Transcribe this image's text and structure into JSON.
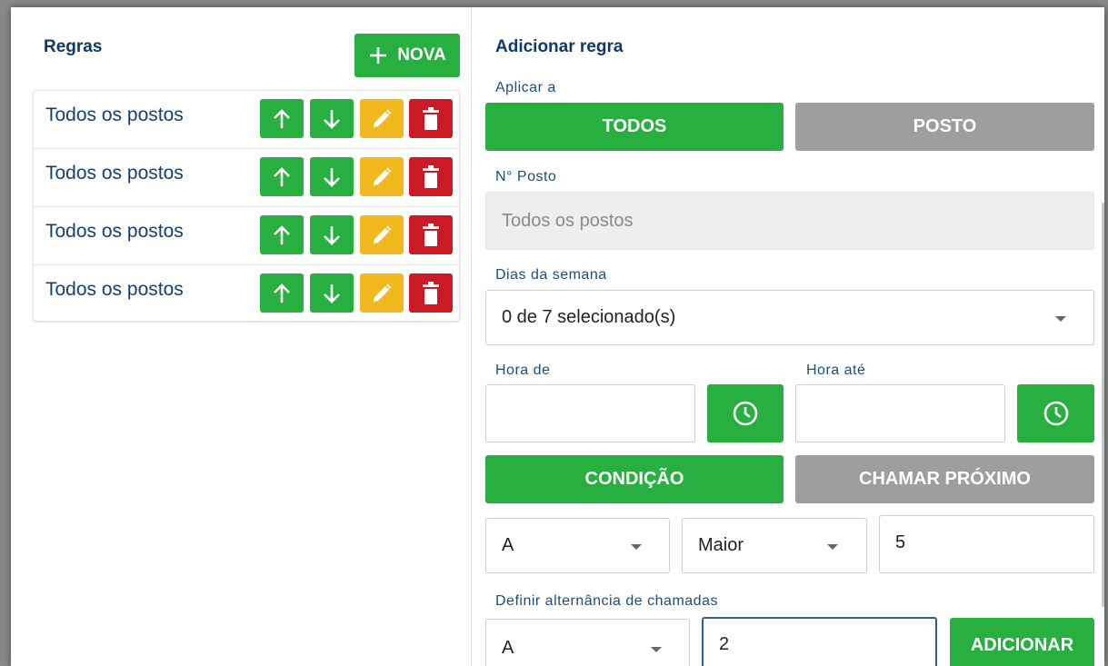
{
  "left": {
    "title": "Regras",
    "new_button": "NOVA",
    "rules": [
      {
        "label": "Todos os postos"
      },
      {
        "label": "Todos os postos"
      },
      {
        "label": "Todos os postos"
      },
      {
        "label": "Todos os postos"
      }
    ]
  },
  "right": {
    "title": "Adicionar regra",
    "apply_label": "Aplicar a",
    "apply_options": {
      "todos": "TODOS",
      "posto": "POSTO"
    },
    "apply_selected": "TODOS",
    "posto_label": "N° Posto",
    "posto_placeholder": "Todos os postos",
    "days_label": "Dias da semana",
    "days_value": "0 de 7 selecionado(s)",
    "hora_de_label": "Hora de",
    "hora_ate_label": "Hora até",
    "mode_options": {
      "condicao": "CONDIÇÃO",
      "chamar": "CHAMAR PRÓXIMO"
    },
    "mode_selected": "CONDIÇÃO",
    "condition": {
      "field": "A",
      "operator": "Maior",
      "value": "5"
    },
    "alternancia_label": "Definir alternância de chamadas",
    "alternancia": {
      "field": "A",
      "value": "2"
    },
    "add_button": "ADICIONAR"
  },
  "colors": {
    "green": "#27b040",
    "gray": "#9e9e9e",
    "yellow": "#f2b81f",
    "red": "#cb1a24",
    "title_blue": "#0e3a69"
  },
  "icons": [
    "plus-icon",
    "arrow-up-icon",
    "arrow-down-icon",
    "pencil-icon",
    "trash-icon",
    "clock-icon",
    "chevron-down-icon"
  ]
}
